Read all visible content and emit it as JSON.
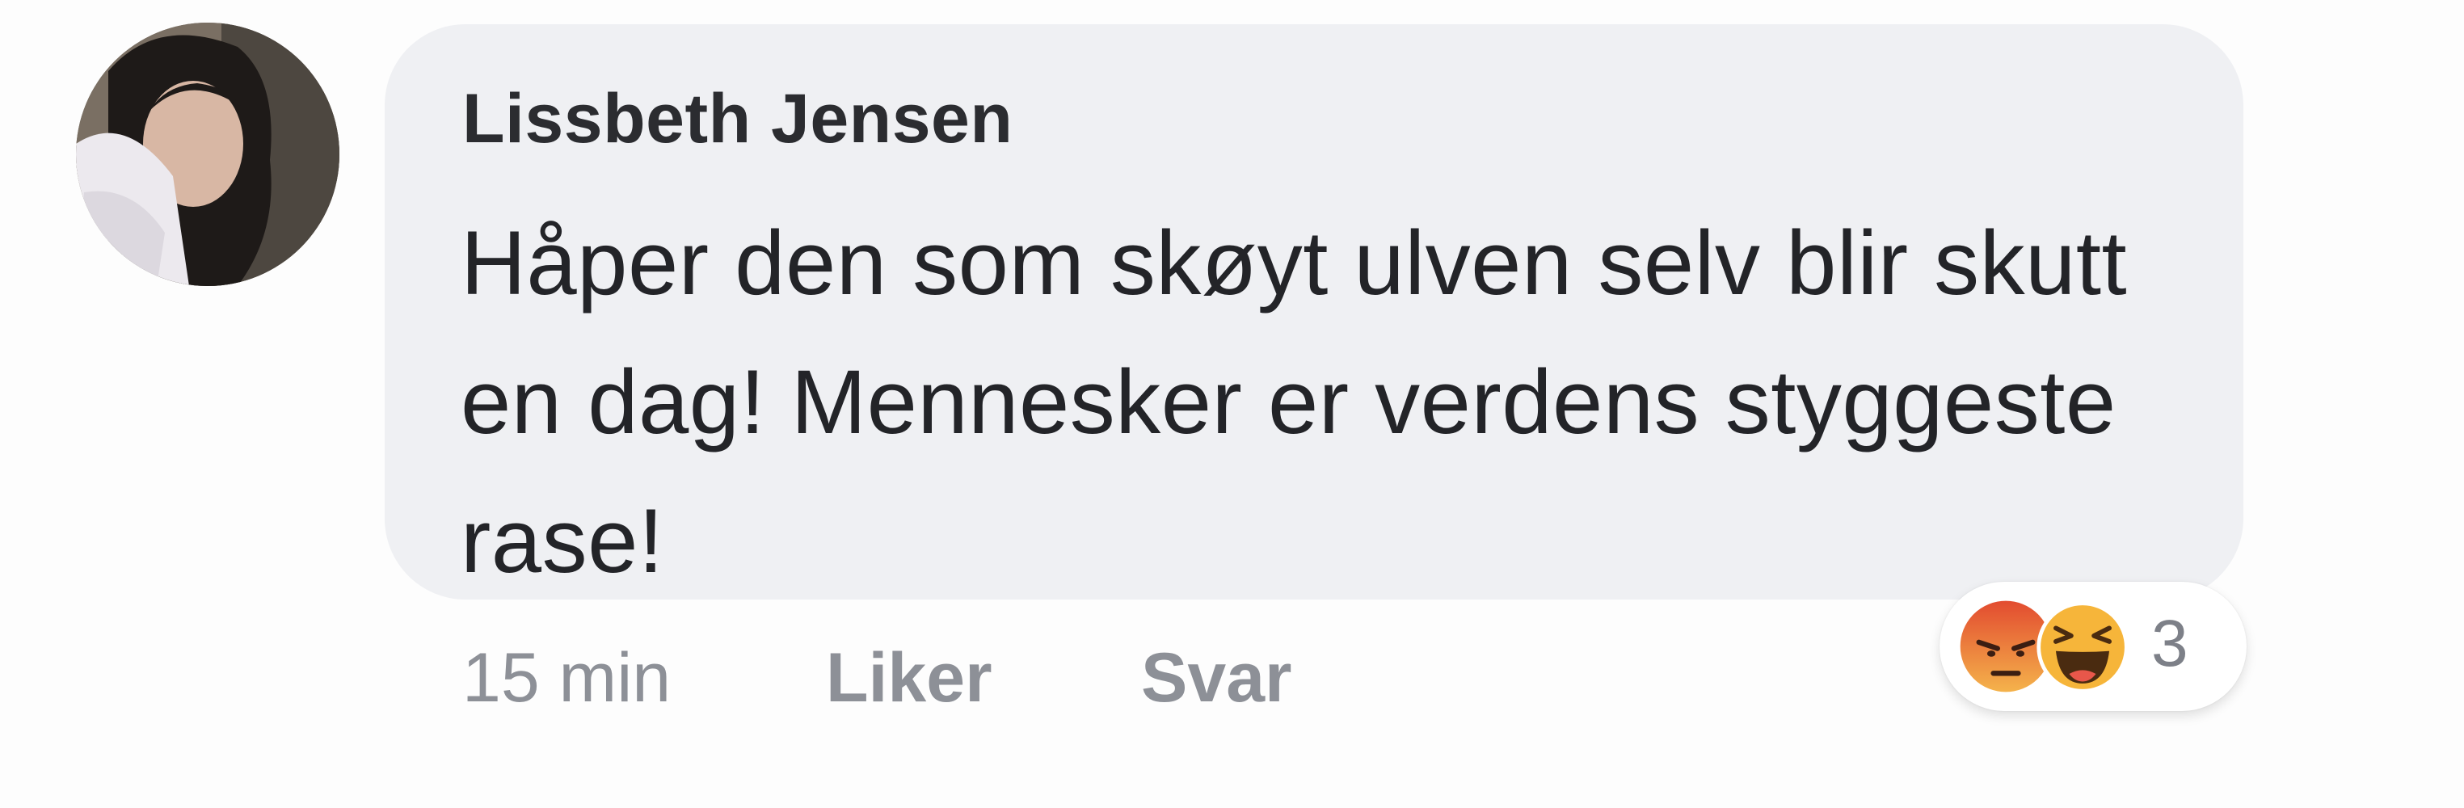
{
  "comment": {
    "author": "Lissbeth Jensen",
    "text": "Håper den som skøyt ulven selv blir skutt en dag! Mennesker er verdens styggeste rase!",
    "avatar": "profile-photo"
  },
  "actions": {
    "timestamp": "15 min",
    "like_label": "Liker",
    "reply_label": "Svar"
  },
  "reactions": {
    "icons": [
      "angry-reaction-icon",
      "haha-reaction-icon"
    ],
    "count": "3"
  },
  "colors": {
    "bubble": "#eff0f3",
    "text": "#232428",
    "secondary_text": "#8d9097",
    "angry": "#e35a35",
    "haha": "#f6b53a"
  }
}
